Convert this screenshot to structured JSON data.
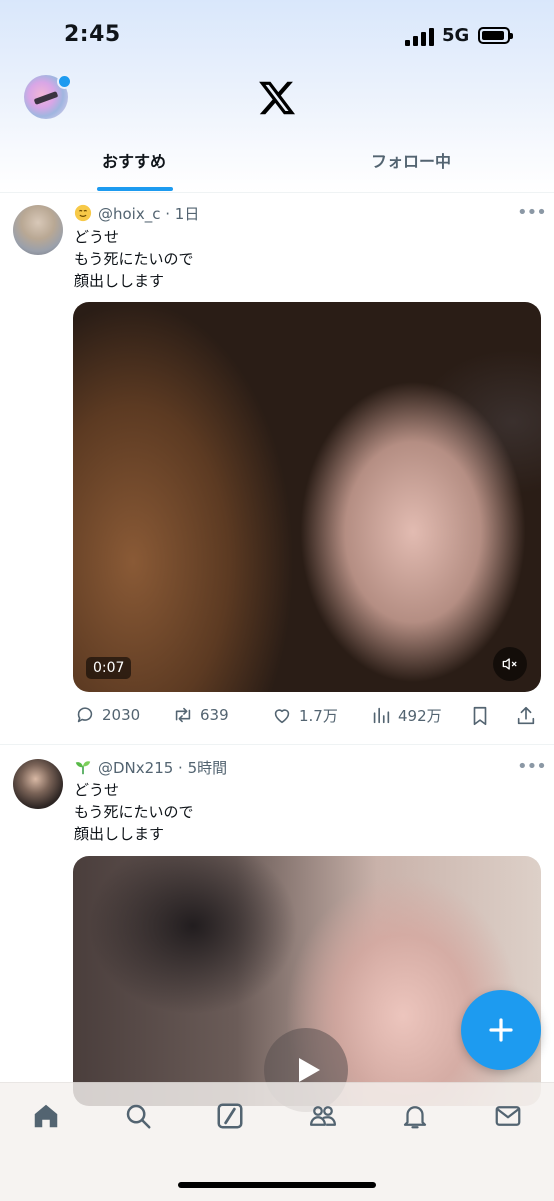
{
  "status_bar": {
    "time": "2:45",
    "network": "5G"
  },
  "header": {
    "logo_icon": "x-logo-icon",
    "tabs": [
      {
        "label": "おすすめ",
        "active": true
      },
      {
        "label": "フォロー中",
        "active": false
      }
    ]
  },
  "posts": [
    {
      "badge_icon": "emoji-badge-icon",
      "handle": "@hoix_c",
      "time": "1日",
      "text_lines": [
        "どうせ",
        "もう死にたいので",
        "顔出しします"
      ],
      "video_duration": "0:07",
      "replies": "2030",
      "reposts": "639",
      "likes": "1.7万",
      "views": "492万"
    },
    {
      "badge_icon": "sprout-badge-icon",
      "handle": "@DNx215",
      "time": "5時間",
      "text_lines": [
        "どうせ",
        "もう死にたいので",
        "顔出しします"
      ]
    }
  ],
  "colors": {
    "accent": "#1d9bf0",
    "secondary_text": "#536471",
    "primary_text": "#0f1419"
  },
  "bottom_nav": [
    "home-icon",
    "search-icon",
    "grok-icon",
    "communities-icon",
    "notifications-icon",
    "messages-icon"
  ]
}
